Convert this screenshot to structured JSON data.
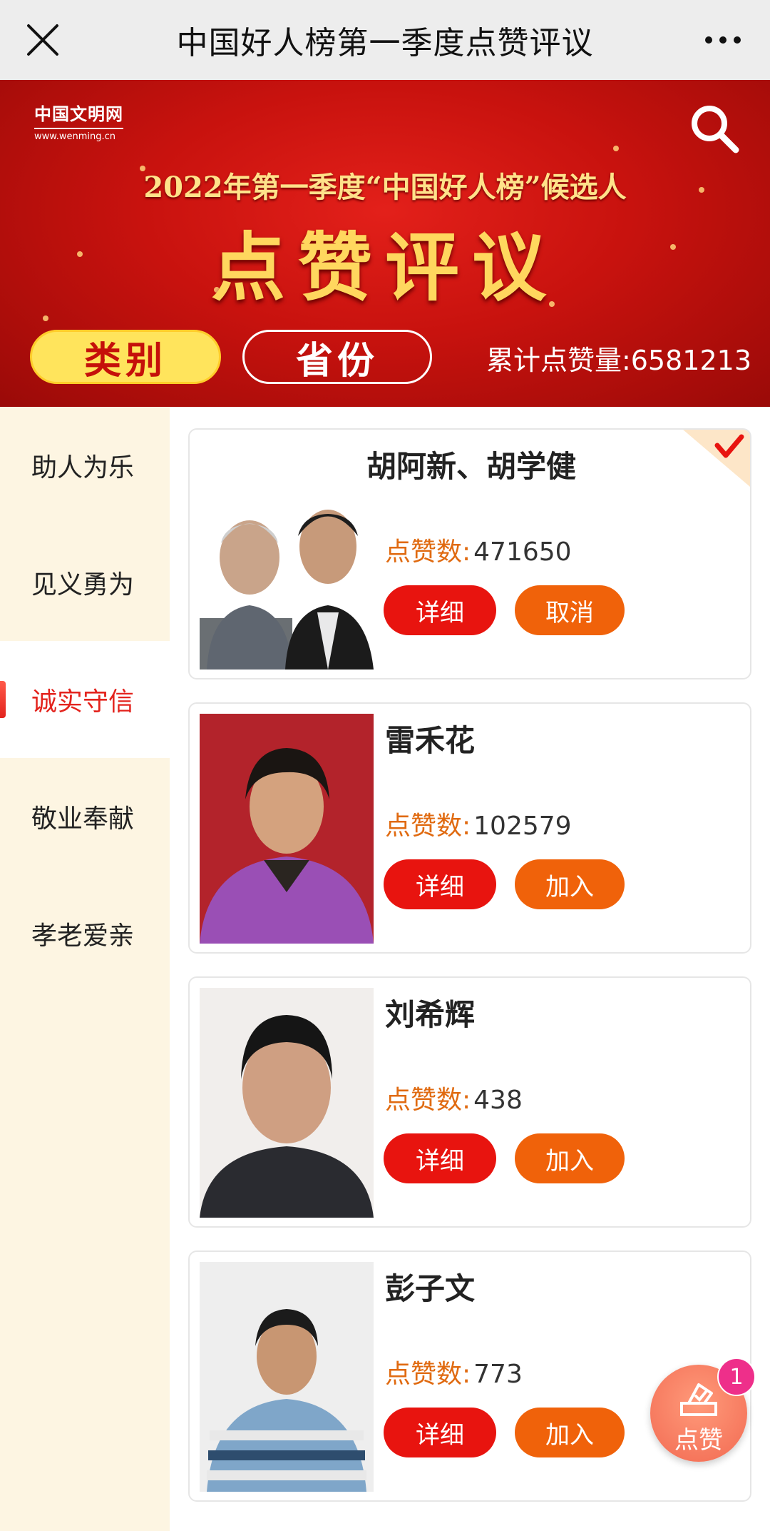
{
  "titlebar": {
    "title": "中国好人榜第一季度点赞评议",
    "close_icon": "close-icon",
    "more_icon": "more-icon"
  },
  "banner": {
    "logo_main": "中国文明网",
    "logo_url": "www.wenming.cn",
    "subtitle": "2022年第一季度“中国好人榜”候选人",
    "main_title": "点赞评议",
    "category_button": "类别",
    "province_button": "省份",
    "total_likes_text": "累计点赞量:6581213"
  },
  "sidebar": {
    "items": [
      {
        "label": "助人为乐",
        "active": false
      },
      {
        "label": "见义勇为",
        "active": false
      },
      {
        "label": "诚实守信",
        "active": true
      },
      {
        "label": "敬业奉献",
        "active": false
      },
      {
        "label": "孝老爱亲",
        "active": false
      }
    ]
  },
  "cards": [
    {
      "name": "胡阿新、胡学健",
      "likes_label": "点赞数:",
      "likes": "471650",
      "detail_label": "详细",
      "action_label": "取消",
      "selected": true
    },
    {
      "name": "雷禾花",
      "likes_label": "点赞数:",
      "likes": "102579",
      "detail_label": "详细",
      "action_label": "加入",
      "selected": false
    },
    {
      "name": "刘希辉",
      "likes_label": "点赞数:",
      "likes": "438",
      "detail_label": "详细",
      "action_label": "加入",
      "selected": false
    },
    {
      "name": "彭子文",
      "likes_label": "点赞数:",
      "likes": "773",
      "detail_label": "详细",
      "action_label": "加入",
      "selected": false
    }
  ],
  "fab": {
    "label": "点赞",
    "badge": "1"
  },
  "colors": {
    "primary_red": "#e8140f",
    "orange": "#f0620a",
    "sidebar_bg": "#fdf5e2",
    "gold": "#ffd75e"
  }
}
